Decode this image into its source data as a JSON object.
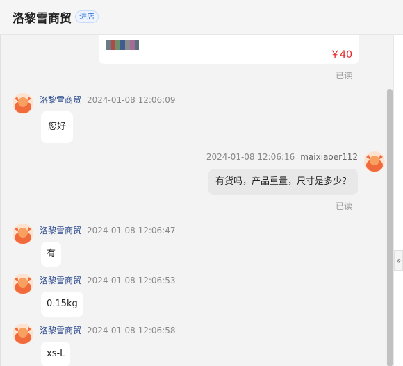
{
  "header": {
    "shop_name": "洛黎雪商贸",
    "badge": "进店"
  },
  "product": {
    "price": "￥40"
  },
  "read_label_1": "已读",
  "read_label_2": "已读",
  "messages": [
    {
      "sender": "洛黎雪商贸",
      "time": "2024-01-08 12:06:09",
      "text": "您好"
    },
    {
      "sender": "maixiaoer112",
      "time": "2024-01-08 12:06:16",
      "text": "有货吗，产品重量，尺寸是多少？"
    },
    {
      "sender": "洛黎雪商贸",
      "time": "2024-01-08 12:06:47",
      "text": "有"
    },
    {
      "sender": "洛黎雪商贸",
      "time": "2024-01-08 12:06:53",
      "text": "0.15kg"
    },
    {
      "sender": "洛黎雪商贸",
      "time": "2024-01-08 12:06:58",
      "text": "xs-L"
    }
  ],
  "side": {
    "collapse_icon": "»"
  },
  "colors": {
    "price": "#e0262a",
    "shop_name_link": "#2c4a8c",
    "badge": "#2b6cd6"
  }
}
